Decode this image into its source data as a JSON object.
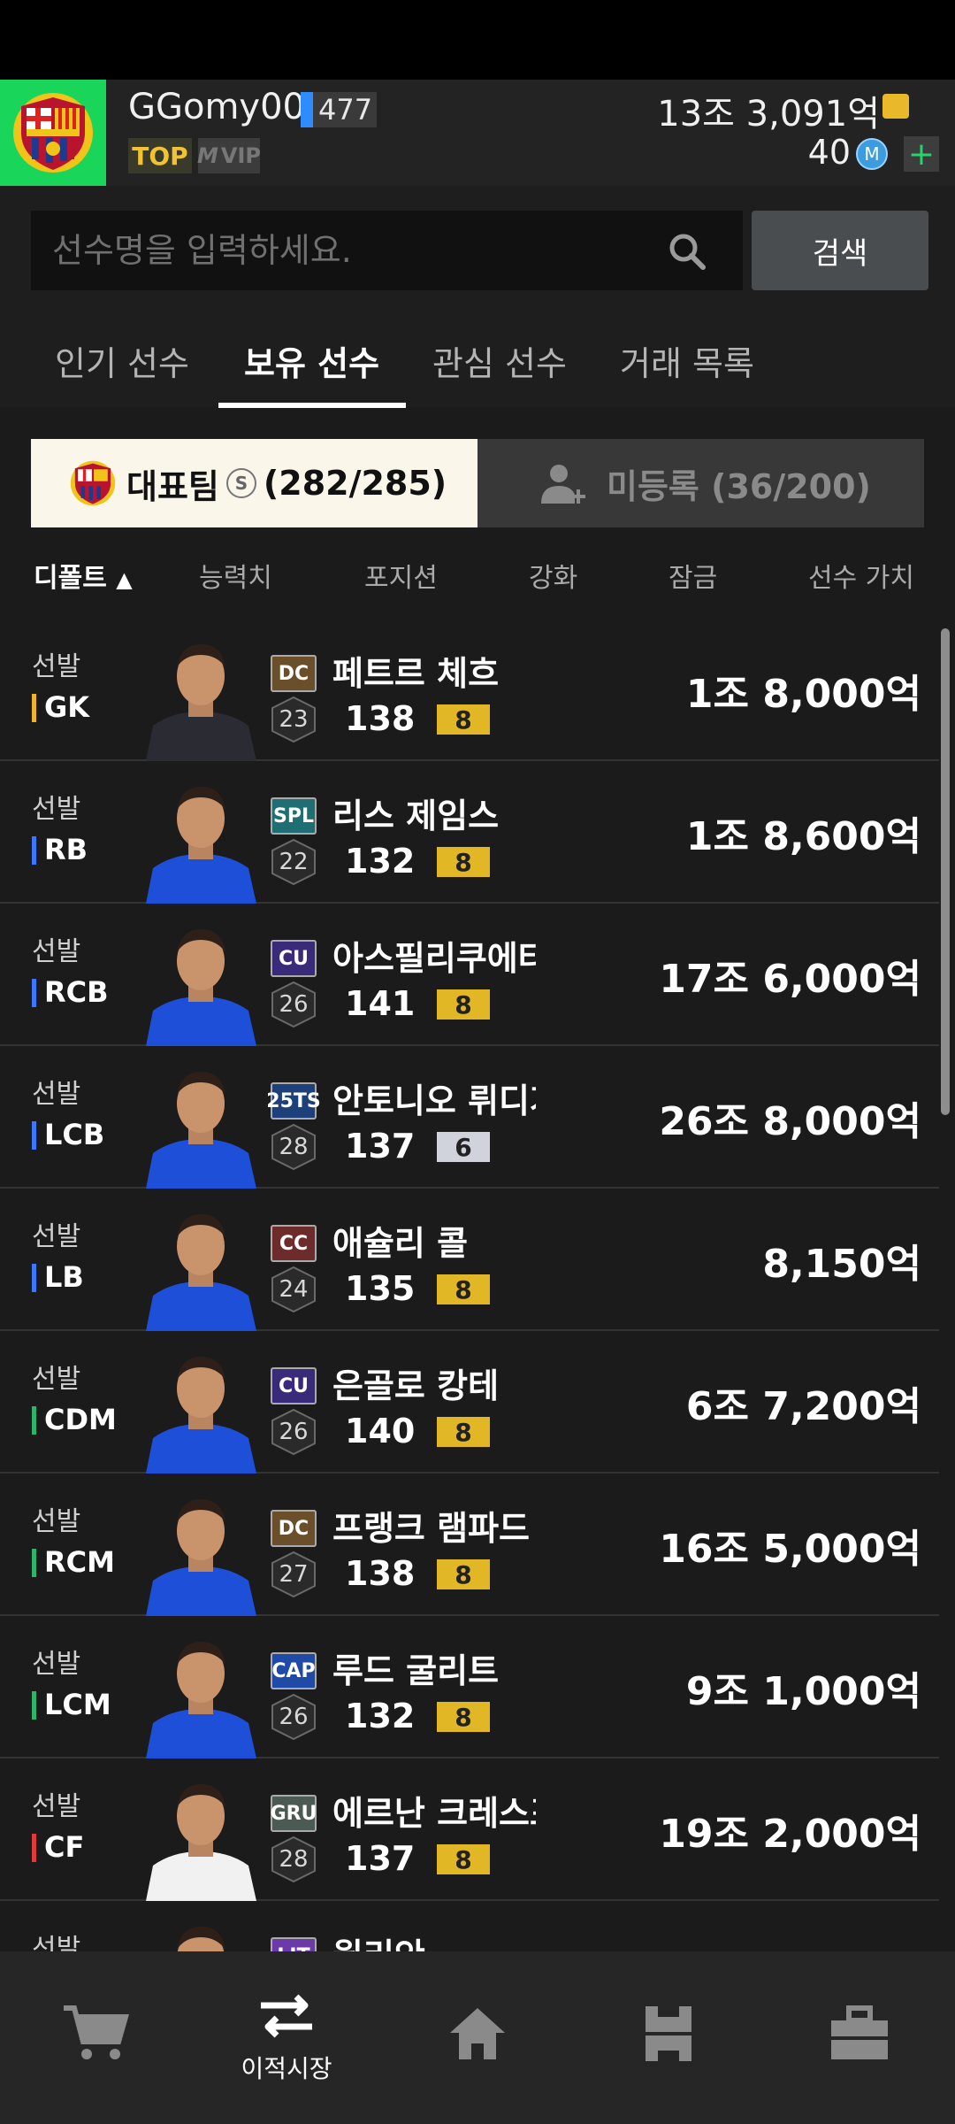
{
  "header": {
    "username": "GGomy00",
    "level": "477",
    "top_badge": "TOP",
    "vip_badge": "VIP",
    "money": "13조 3,091억",
    "coins": "40",
    "coin_symbol": "M",
    "plus": "+"
  },
  "search": {
    "placeholder": "선수명을 입력하세요.",
    "button": "검색"
  },
  "tabs": [
    "인기 선수",
    "보유 선수",
    "관심 선수",
    "거래 목록"
  ],
  "active_tab": "보유 선수",
  "toggle": {
    "main_label": "대표팀",
    "s_badge": "S",
    "main_count": "(282/285)",
    "unregistered": "미등록 (36/200)"
  },
  "sort": {
    "items": [
      "디폴트",
      "능력치",
      "포지션",
      "강화",
      "잠금",
      "선수 가치"
    ],
    "active_arrow": "▲"
  },
  "players": [
    {
      "role": "선발",
      "pos": "GK",
      "pos_color": "#f0b429",
      "season": "DC",
      "season_color": "#6b4e2a",
      "ovr": "23",
      "name": "페트르 체흐",
      "rating": "138",
      "grade": "8",
      "grade_color": "#e2b726",
      "price": "1조 8,000억",
      "kit": "#2b2b33"
    },
    {
      "role": "선발",
      "pos": "RB",
      "pos_color": "#3a78ff",
      "season": "SPL",
      "season_color": "#1e6e73",
      "ovr": "22",
      "name": "리스 제임스",
      "rating": "132",
      "grade": "8",
      "grade_color": "#e2b726",
      "price": "1조 8,600억",
      "kit": "#1e4fd8"
    },
    {
      "role": "선발",
      "pos": "RCB",
      "pos_color": "#3a78ff",
      "season": "CU",
      "season_color": "#3a2a7a",
      "ovr": "26",
      "name": "아스필리쿠에타",
      "rating": "141",
      "grade": "8",
      "grade_color": "#e2b726",
      "price": "17조 6,000억",
      "kit": "#1e4fd8"
    },
    {
      "role": "선발",
      "pos": "LCB",
      "pos_color": "#3a78ff",
      "season": "25TS",
      "season_color": "#1d3f7a",
      "ovr": "28",
      "name": "안토니오 뤼디거",
      "rating": "137",
      "grade": "6",
      "grade_color": "#d0d3db",
      "price": "26조 8,000억",
      "kit": "#1e4fd8"
    },
    {
      "role": "선발",
      "pos": "LB",
      "pos_color": "#3a78ff",
      "season": "CC",
      "season_color": "#6e2b2b",
      "ovr": "24",
      "name": "애슐리 콜",
      "rating": "135",
      "grade": "8",
      "grade_color": "#e2b726",
      "price": "8,150억",
      "kit": "#1e4fd8"
    },
    {
      "role": "선발",
      "pos": "CDM",
      "pos_color": "#2fb36a",
      "season": "CU",
      "season_color": "#3a2a7a",
      "ovr": "26",
      "name": "은골로 캉테",
      "rating": "140",
      "grade": "8",
      "grade_color": "#e2b726",
      "price": "6조 7,200억",
      "kit": "#1e4fd8"
    },
    {
      "role": "선발",
      "pos": "RCM",
      "pos_color": "#2fb36a",
      "season": "DC",
      "season_color": "#6b4e2a",
      "ovr": "27",
      "name": "프랭크 램파드",
      "rating": "138",
      "grade": "8",
      "grade_color": "#e2b726",
      "price": "16조 5,000억",
      "kit": "#1e4fd8"
    },
    {
      "role": "선발",
      "pos": "LCM",
      "pos_color": "#2fb36a",
      "season": "CAP",
      "season_color": "#1f4aa8",
      "ovr": "26",
      "name": "루드 굴리트",
      "rating": "132",
      "grade": "8",
      "grade_color": "#e2b726",
      "price": "9조 1,000억",
      "kit": "#1e4fd8"
    },
    {
      "role": "선발",
      "pos": "CF",
      "pos_color": "#e03a3a",
      "season": "GRU",
      "season_color": "#4b5a52",
      "ovr": "28",
      "name": "에르난 크레스포",
      "rating": "137",
      "grade": "8",
      "grade_color": "#e2b726",
      "price": "19조 2,000억",
      "kit": "#f1f1f1"
    },
    {
      "role": "선발",
      "pos": "",
      "pos_color": "#e03a3a",
      "season": "LIT",
      "season_color": "#6b3aa8",
      "ovr": "",
      "name": "윌리안",
      "rating": "",
      "grade": "",
      "grade_color": "#e2b726",
      "price": "",
      "kit": "#1e4fd8"
    }
  ],
  "bottom_nav": {
    "items": [
      "",
      "이적시장",
      "",
      "",
      ""
    ]
  }
}
